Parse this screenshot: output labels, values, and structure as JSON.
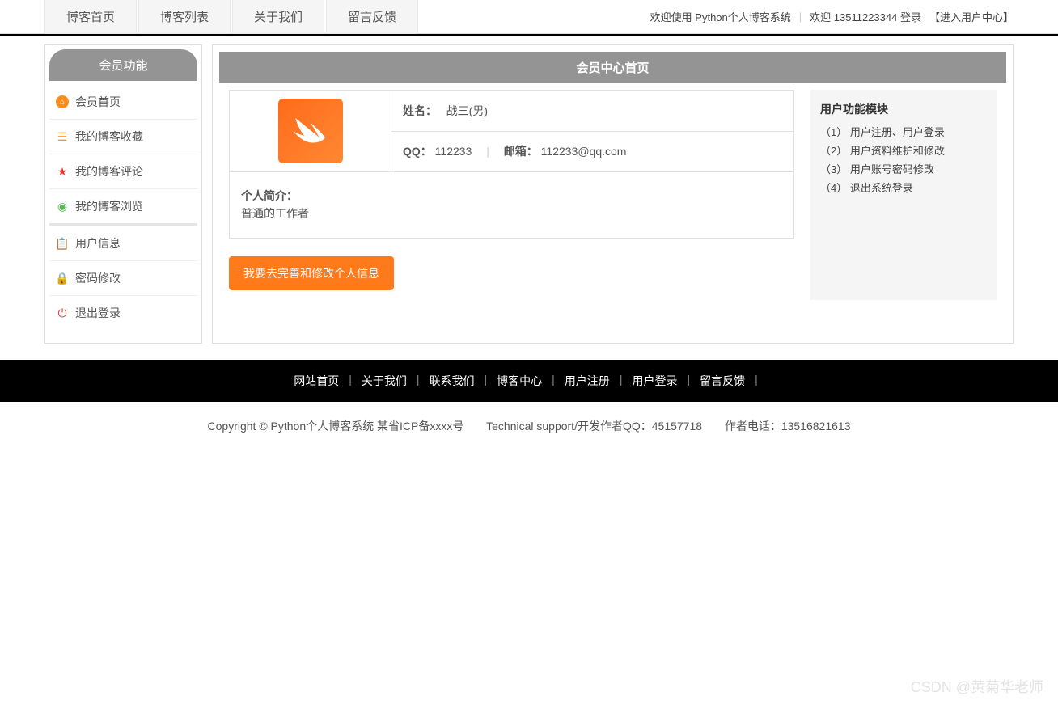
{
  "nav": {
    "items": [
      "博客首页",
      "博客列表",
      "关于我们",
      "留言反馈"
    ],
    "welcome_prefix": "欢迎使用 ",
    "system_name": "Python个人博客系统",
    "welcome_user_prefix": "欢迎 ",
    "phone": "13511223344",
    "login_suffix": " 登录",
    "user_center": "【进入用户中心】"
  },
  "sidebar": {
    "title": "会员功能",
    "group1": [
      {
        "label": "会员首页"
      },
      {
        "label": "我的博客收藏"
      },
      {
        "label": "我的博客评论"
      },
      {
        "label": "我的博客浏览"
      }
    ],
    "group2": [
      {
        "label": "用户信息"
      },
      {
        "label": "密码修改"
      },
      {
        "label": "退出登录"
      }
    ]
  },
  "content": {
    "title": "会员中心首页",
    "name_label": "姓名：",
    "name_value": "战三(男)",
    "qq_label": "QQ：",
    "qq_value": "112233",
    "email_label": "邮箱：",
    "email_value": "112233@qq.com",
    "bio_label": "个人简介：",
    "bio_value": "普通的工作者",
    "edit_button": "我要去完善和修改个人信息"
  },
  "panel": {
    "title": "用户功能模块",
    "items": [
      "（1） 用户注册、用户登录",
      "（2） 用户资料维护和修改",
      "（3） 用户账号密码修改",
      "（4） 退出系统登录"
    ]
  },
  "footer": {
    "links": [
      "网站首页",
      "关于我们",
      "联系我们",
      "博客中心",
      "用户注册",
      "用户登录",
      "留言反馈"
    ],
    "copyright": "Copyright © Python个人博客系统 某省ICP备xxxx号",
    "support": "Technical support/开发作者QQ：45157718",
    "author_tel": "作者电话：13516821613"
  },
  "watermark": "CSDN @黄菊华老师"
}
